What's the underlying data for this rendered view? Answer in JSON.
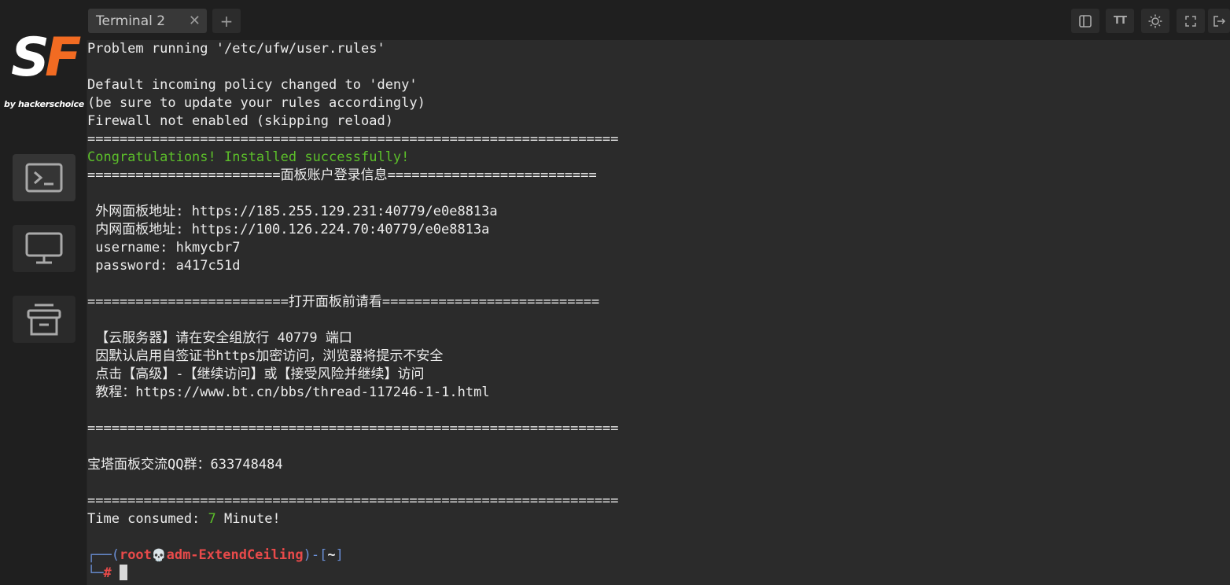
{
  "app": {
    "logo_s": "S",
    "logo_f": "F",
    "logo_sub": "by hackerschoice",
    "accent": "#f26b22"
  },
  "tabs": [
    {
      "label": "Terminal 2",
      "close": "✕"
    }
  ],
  "add_tab": "+",
  "toolbar": {
    "font_label": "TT"
  },
  "terminal": {
    "lines": [
      "Problem running '/etc/ufw/user.rules'",
      "",
      "Default incoming policy changed to 'deny'",
      "(be sure to update your rules accordingly)",
      "Firewall not enabled (skipping reload)",
      "==================================================================",
      "Congratulations! Installed successfully!",
      "========================面板账户登录信息==========================",
      "",
      " 外网面板地址: https://185.255.129.231:40779/e0e8813a",
      " 内网面板地址: https://100.126.224.70:40779/e0e8813a",
      " username: hkmycbr7",
      " password: a417c51d",
      "",
      "=========================打开面板前请看===========================",
      "",
      " 【云服务器】请在安全组放行 40779 端口",
      " 因默认启用自签证书https加密访问，浏览器将提示不安全",
      " 点击【高级】-【继续访问】或【接受风险并继续】访问",
      " 教程：https://www.bt.cn/bbs/thread-117246-1-1.html",
      "",
      "==================================================================",
      "",
      "宝塔面板交流QQ群：633748484",
      "",
      "==================================================================",
      ""
    ],
    "time_label": "Time consumed: ",
    "time_value": "7",
    "time_unit": " Minute!",
    "prompt": {
      "corner_top": "┌──(",
      "user": "root",
      "skull": "💀",
      "host": "adm-ExtendCeiling",
      "mid": ")-[",
      "dir": "~",
      "end": "]",
      "corner_bottom": "└─",
      "symbol": "#"
    }
  },
  "colors": {
    "green": "#5cbf2a",
    "red": "#e84a4a",
    "blue": "#6a8fd6"
  }
}
